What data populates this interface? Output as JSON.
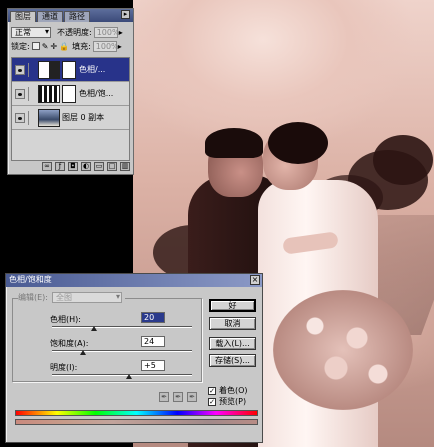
{
  "layers_panel": {
    "tabs": [
      "图层",
      "通道",
      "路径"
    ],
    "blend_mode": "正常",
    "opacity_label": "不透明度:",
    "opacity_value": "100%",
    "lock_label": "锁定:",
    "fill_label": "填充:",
    "fill_value": "100%",
    "layers": [
      {
        "name": "色相/...",
        "selected": true
      },
      {
        "name": "色相/饱...",
        "selected": false
      },
      {
        "name": "图层 0 副本",
        "selected": false
      }
    ]
  },
  "dialog": {
    "title": "色相/饱和度",
    "edit_label": "编辑(E):",
    "edit_value": "全图",
    "hue_label": "色相(H):",
    "hue_value": "20",
    "saturation_label": "饱和度(A):",
    "saturation_value": "24",
    "lightness_label": "明度(I):",
    "lightness_value": "+5",
    "buttons": {
      "ok": "好",
      "cancel": "取消",
      "load": "载入(L)...",
      "save": "存储(S)..."
    },
    "colorize_label": "着色(O)",
    "preview_label": "预览(P)",
    "colorize_checked": true,
    "preview_checked": true,
    "hue_fraction": 0.3,
    "saturation_fraction": 0.22,
    "lightness_fraction": 0.55
  },
  "colors": {
    "photo_tone": "#d9ada2",
    "selected_layer": "#28338a",
    "dialog_title": "#4a5b93"
  }
}
